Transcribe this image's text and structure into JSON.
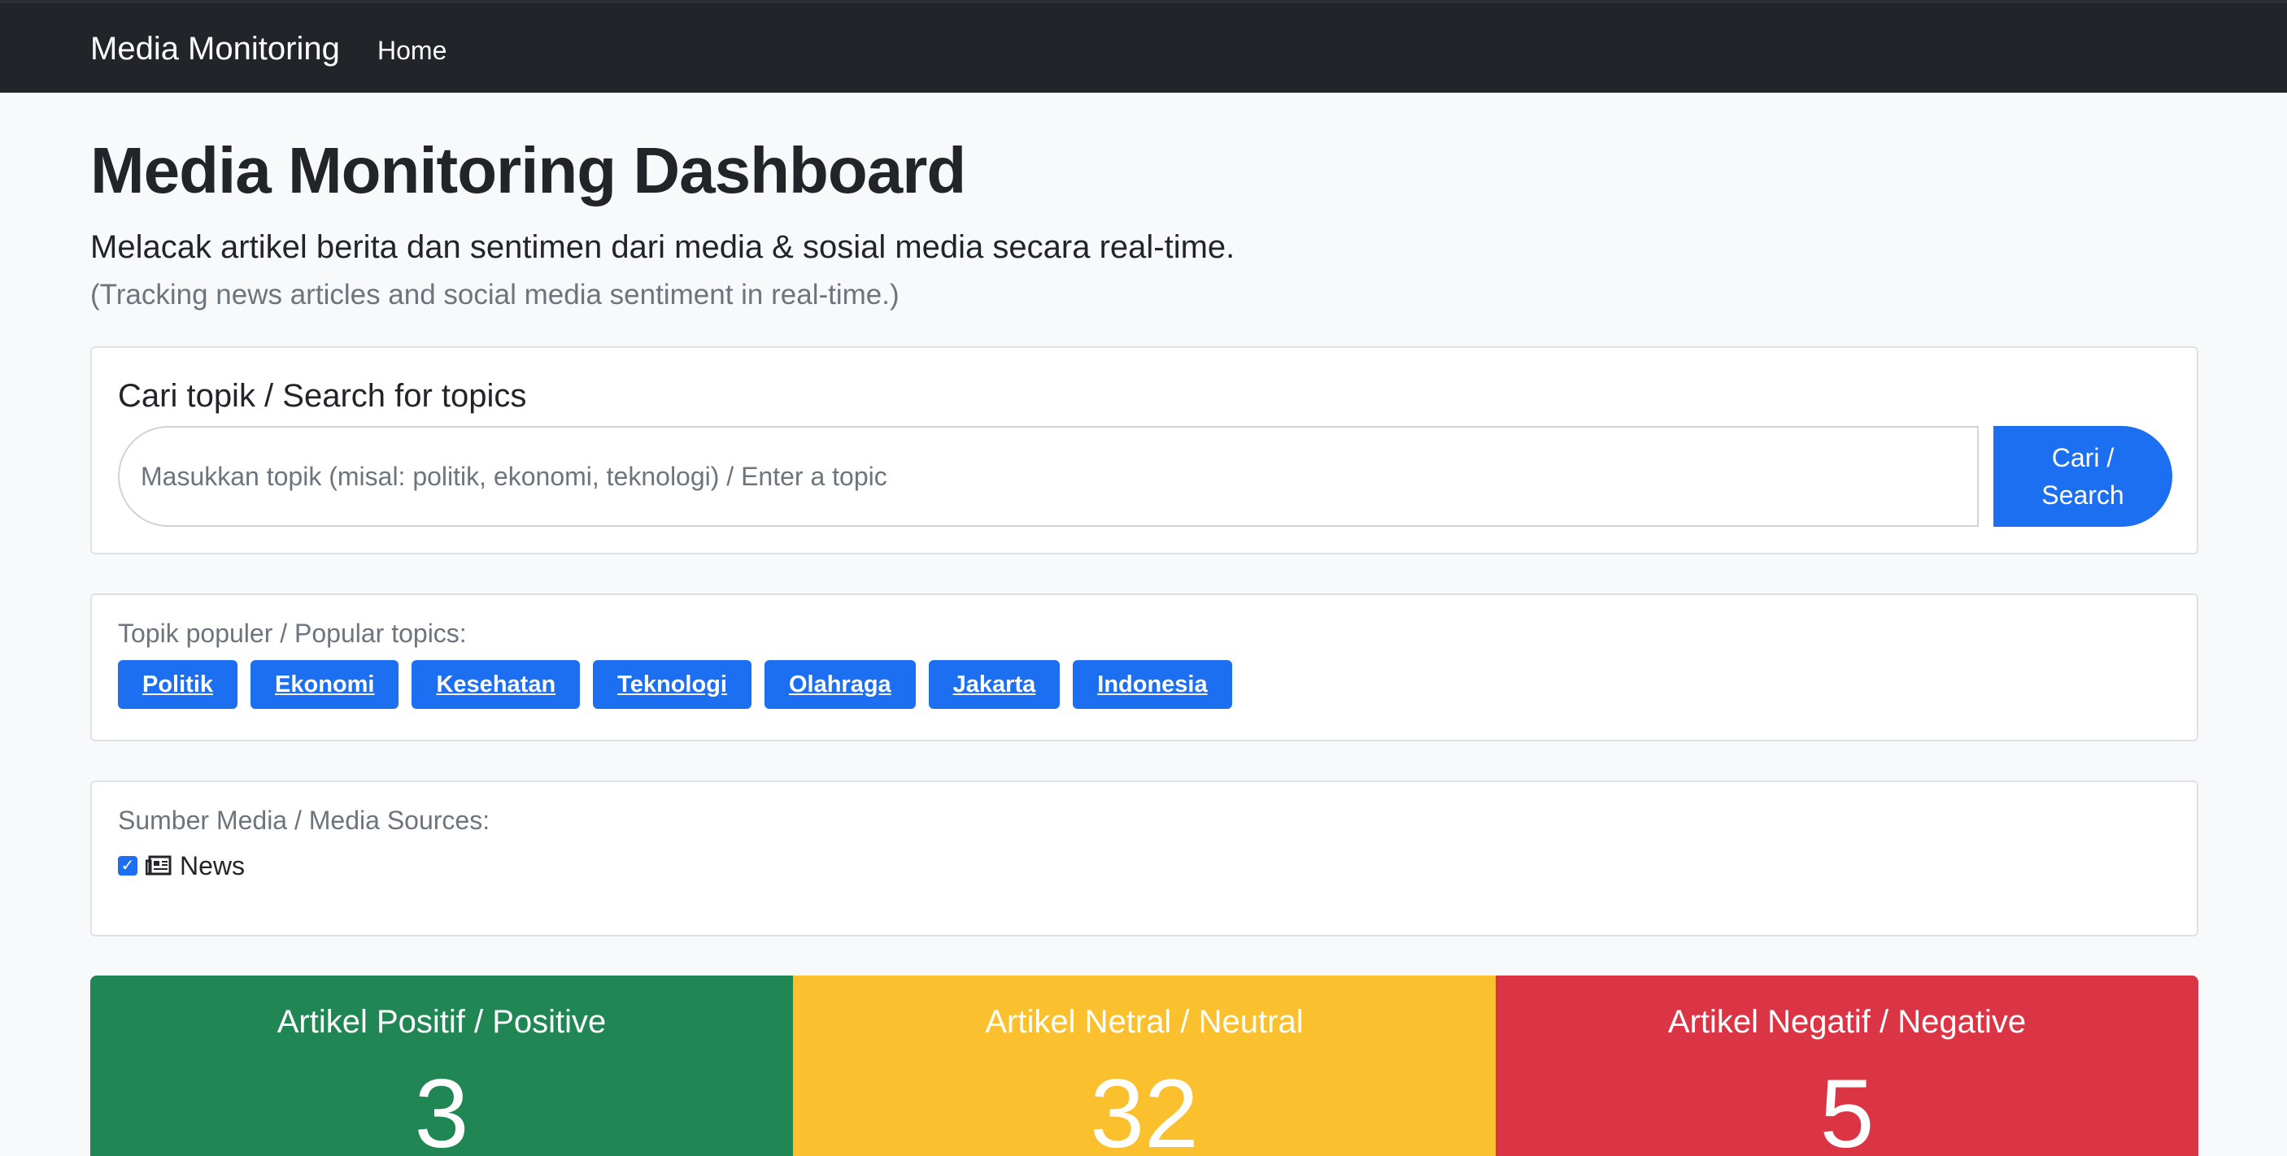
{
  "navbar": {
    "brand": "Media Monitoring",
    "links": [
      {
        "label": "Home"
      }
    ]
  },
  "header": {
    "title": "Media Monitoring Dashboard",
    "subtitle_id": "Melacak artikel berita dan sentimen dari media & sosial media secara real-time.",
    "subtitle_en": "(Tracking news articles and social media sentiment in real-time.)"
  },
  "search": {
    "title": "Cari topik / Search for topics",
    "placeholder": "Masukkan topik (misal: politik, ekonomi, teknologi) / Enter a topic",
    "value": "",
    "button_line1": "Cari /",
    "button_line2": "Search"
  },
  "topics": {
    "label": "Topik populer / Popular topics:",
    "items": [
      "Politik",
      "Ekonomi",
      "Kesehatan",
      "Teknologi",
      "Olahraga",
      "Jakarta",
      "Indonesia"
    ]
  },
  "sources": {
    "label": "Sumber Media / Media Sources:",
    "items": [
      {
        "label": "News",
        "checked": true,
        "icon": "newspaper-icon"
      }
    ]
  },
  "stats": {
    "positive": {
      "title": "Artikel Positif / Positive",
      "value": "3",
      "color": "#208654"
    },
    "neutral": {
      "title": "Artikel Netral / Neutral",
      "value": "32",
      "color": "#fbc02d"
    },
    "negative": {
      "title": "Artikel Negatif / Negative",
      "value": "5",
      "color": "#db3545"
    }
  },
  "colors": {
    "accent": "#1d6ff2",
    "navbar": "#212529",
    "background": "#f8f9fa"
  }
}
